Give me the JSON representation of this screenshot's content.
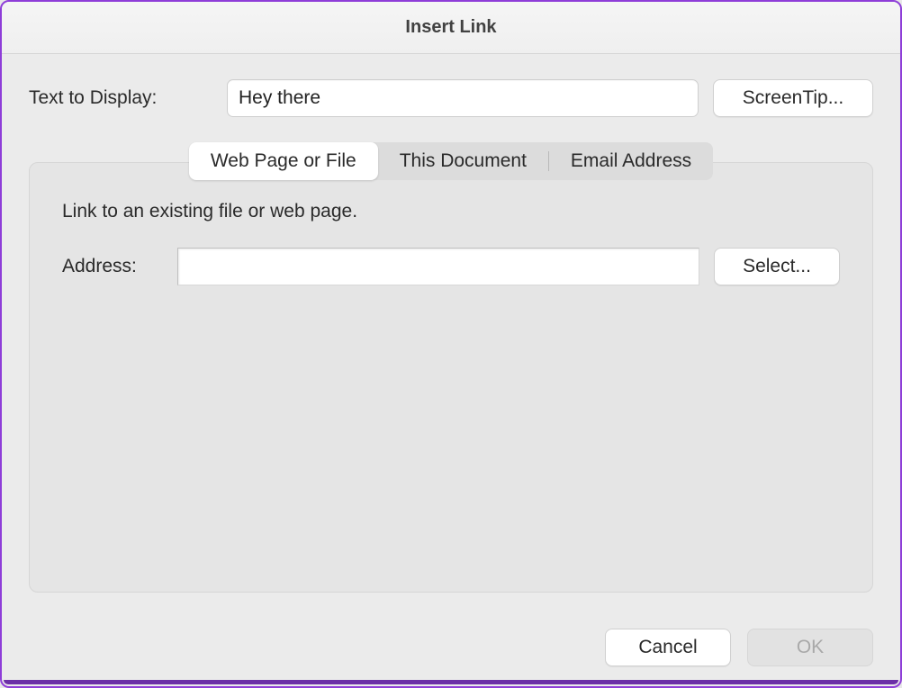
{
  "dialog": {
    "title": "Insert Link"
  },
  "text_to_display": {
    "label": "Text to Display:",
    "value": "Hey there"
  },
  "screentip": {
    "label": "ScreenTip..."
  },
  "tabs": {
    "web": "Web Page or File",
    "doc": "This Document",
    "email": "Email Address",
    "active": "web"
  },
  "panel": {
    "description": "Link to an existing file or web page.",
    "address_label": "Address:",
    "address_value": "",
    "select_label": "Select..."
  },
  "footer": {
    "cancel": "Cancel",
    "ok": "OK"
  }
}
